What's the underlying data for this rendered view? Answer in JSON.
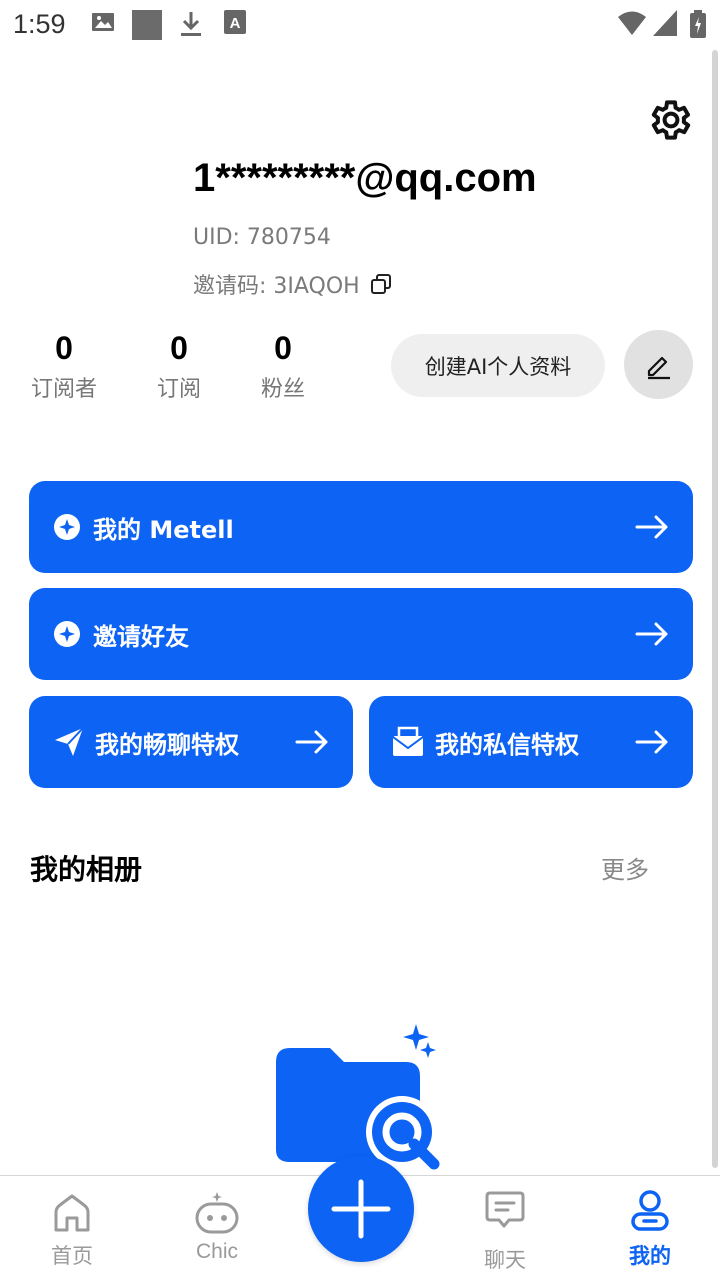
{
  "status_bar": {
    "time": "1:59"
  },
  "profile": {
    "email": "1*********@qq.com",
    "uid": "UID: 780754",
    "invite_code": "邀请码: 3IAQOH"
  },
  "stats": [
    {
      "value": "0",
      "label": "订阅者"
    },
    {
      "value": "0",
      "label": "订阅"
    },
    {
      "value": "0",
      "label": "粉丝"
    }
  ],
  "actions": {
    "create_ai_profile": "创建AI个人资料"
  },
  "cards": {
    "my_metell": "我的 Metell",
    "invite_friends": "邀请好友",
    "chat_privilege": "我的畅聊特权",
    "message_privilege": "我的私信特权"
  },
  "album": {
    "title": "我的相册",
    "more": "更多"
  },
  "tabbar": {
    "items": [
      {
        "label": "首页",
        "icon": "home-icon"
      },
      {
        "label": "Chic",
        "icon": "robot-icon"
      },
      {
        "label": "聊天",
        "icon": "chat-icon"
      },
      {
        "label": "我的",
        "icon": "profile-icon",
        "active": true
      }
    ]
  },
  "colors": {
    "accent": "#0d63f3",
    "muted": "#9a9a9a",
    "chip": "#efefef"
  }
}
